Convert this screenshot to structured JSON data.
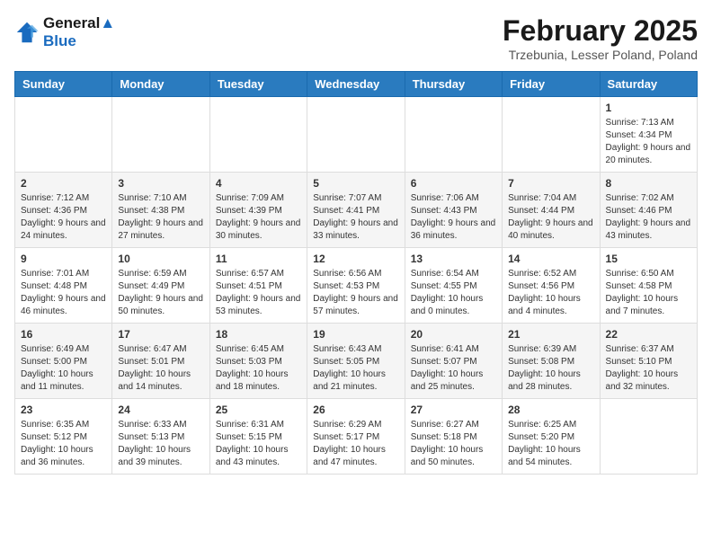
{
  "header": {
    "logo_line1": "General",
    "logo_line2": "Blue",
    "month_title": "February 2025",
    "location": "Trzebunia, Lesser Poland, Poland"
  },
  "weekdays": [
    "Sunday",
    "Monday",
    "Tuesday",
    "Wednesday",
    "Thursday",
    "Friday",
    "Saturday"
  ],
  "weeks": [
    [
      null,
      null,
      null,
      null,
      null,
      null,
      {
        "day": "1",
        "sunrise": "7:13 AM",
        "sunset": "4:34 PM",
        "daylight": "9 hours and 20 minutes."
      }
    ],
    [
      {
        "day": "2",
        "sunrise": "7:12 AM",
        "sunset": "4:36 PM",
        "daylight": "9 hours and 24 minutes."
      },
      {
        "day": "3",
        "sunrise": "7:10 AM",
        "sunset": "4:38 PM",
        "daylight": "9 hours and 27 minutes."
      },
      {
        "day": "4",
        "sunrise": "7:09 AM",
        "sunset": "4:39 PM",
        "daylight": "9 hours and 30 minutes."
      },
      {
        "day": "5",
        "sunrise": "7:07 AM",
        "sunset": "4:41 PM",
        "daylight": "9 hours and 33 minutes."
      },
      {
        "day": "6",
        "sunrise": "7:06 AM",
        "sunset": "4:43 PM",
        "daylight": "9 hours and 36 minutes."
      },
      {
        "day": "7",
        "sunrise": "7:04 AM",
        "sunset": "4:44 PM",
        "daylight": "9 hours and 40 minutes."
      },
      {
        "day": "8",
        "sunrise": "7:02 AM",
        "sunset": "4:46 PM",
        "daylight": "9 hours and 43 minutes."
      }
    ],
    [
      {
        "day": "9",
        "sunrise": "7:01 AM",
        "sunset": "4:48 PM",
        "daylight": "9 hours and 46 minutes."
      },
      {
        "day": "10",
        "sunrise": "6:59 AM",
        "sunset": "4:49 PM",
        "daylight": "9 hours and 50 minutes."
      },
      {
        "day": "11",
        "sunrise": "6:57 AM",
        "sunset": "4:51 PM",
        "daylight": "9 hours and 53 minutes."
      },
      {
        "day": "12",
        "sunrise": "6:56 AM",
        "sunset": "4:53 PM",
        "daylight": "9 hours and 57 minutes."
      },
      {
        "day": "13",
        "sunrise": "6:54 AM",
        "sunset": "4:55 PM",
        "daylight": "10 hours and 0 minutes."
      },
      {
        "day": "14",
        "sunrise": "6:52 AM",
        "sunset": "4:56 PM",
        "daylight": "10 hours and 4 minutes."
      },
      {
        "day": "15",
        "sunrise": "6:50 AM",
        "sunset": "4:58 PM",
        "daylight": "10 hours and 7 minutes."
      }
    ],
    [
      {
        "day": "16",
        "sunrise": "6:49 AM",
        "sunset": "5:00 PM",
        "daylight": "10 hours and 11 minutes."
      },
      {
        "day": "17",
        "sunrise": "6:47 AM",
        "sunset": "5:01 PM",
        "daylight": "10 hours and 14 minutes."
      },
      {
        "day": "18",
        "sunrise": "6:45 AM",
        "sunset": "5:03 PM",
        "daylight": "10 hours and 18 minutes."
      },
      {
        "day": "19",
        "sunrise": "6:43 AM",
        "sunset": "5:05 PM",
        "daylight": "10 hours and 21 minutes."
      },
      {
        "day": "20",
        "sunrise": "6:41 AM",
        "sunset": "5:07 PM",
        "daylight": "10 hours and 25 minutes."
      },
      {
        "day": "21",
        "sunrise": "6:39 AM",
        "sunset": "5:08 PM",
        "daylight": "10 hours and 28 minutes."
      },
      {
        "day": "22",
        "sunrise": "6:37 AM",
        "sunset": "5:10 PM",
        "daylight": "10 hours and 32 minutes."
      }
    ],
    [
      {
        "day": "23",
        "sunrise": "6:35 AM",
        "sunset": "5:12 PM",
        "daylight": "10 hours and 36 minutes."
      },
      {
        "day": "24",
        "sunrise": "6:33 AM",
        "sunset": "5:13 PM",
        "daylight": "10 hours and 39 minutes."
      },
      {
        "day": "25",
        "sunrise": "6:31 AM",
        "sunset": "5:15 PM",
        "daylight": "10 hours and 43 minutes."
      },
      {
        "day": "26",
        "sunrise": "6:29 AM",
        "sunset": "5:17 PM",
        "daylight": "10 hours and 47 minutes."
      },
      {
        "day": "27",
        "sunrise": "6:27 AM",
        "sunset": "5:18 PM",
        "daylight": "10 hours and 50 minutes."
      },
      {
        "day": "28",
        "sunrise": "6:25 AM",
        "sunset": "5:20 PM",
        "daylight": "10 hours and 54 minutes."
      },
      null
    ]
  ]
}
